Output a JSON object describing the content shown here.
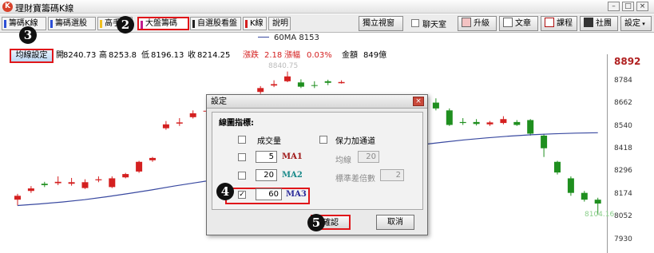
{
  "window": {
    "title": "理財寶籌碼K線",
    "icon_letter": "K"
  },
  "tabs": [
    {
      "label": "籌碼K線",
      "bar_color": "#2d4fd6"
    },
    {
      "label": "籌碼選股",
      "bar_color": "#2d4fd6"
    },
    {
      "label": "高手",
      "bar_color": "#f0c020"
    },
    {
      "label": "大盤籌碼",
      "bar_color": "#c01f8e"
    },
    {
      "label": "自選股看盤",
      "bar_color": "#222222"
    },
    {
      "label": "K線",
      "bar_color": "#d42020"
    },
    {
      "label": "說明",
      "bar_color": "#888888"
    }
  ],
  "toolbar": {
    "standalone_window": "獨立視窗",
    "chat_room": "聊天室",
    "upgrade": "升級",
    "article": "文章",
    "course": "課程",
    "community": "社團",
    "settings": "設定"
  },
  "chart": {
    "legend_ma": "60MA 8153",
    "ma_settings_button": "均線設定",
    "info": {
      "open_label": "開",
      "open": "8240.73",
      "high_label": "高",
      "high": "8253.8",
      "low_label": "低",
      "low": "8196.13",
      "close_label": "收",
      "close": "8214.25",
      "change_label": "漲跌",
      "change": "2.18",
      "pct_label": "漲幅",
      "pct": "0.03%",
      "amount_label": "金額",
      "amount": "849億"
    },
    "price_top": "8892",
    "price_ticks": [
      "8784",
      "8662",
      "8540",
      "8418",
      "8296",
      "8174",
      "8052",
      "7930"
    ],
    "high_annotation": "8840.75",
    "low_annotation": "8104.16"
  },
  "chart_data": {
    "type": "candlestick",
    "ylim": [
      7930,
      8892
    ],
    "ma_line_60": [
      8150,
      8158,
      8168,
      8180,
      8195,
      8212,
      8230,
      8250,
      8268,
      8285,
      8300,
      8318,
      8340,
      8362,
      8385,
      8410,
      8430,
      8448,
      8462,
      8475,
      8488,
      8498,
      8507,
      8514,
      8519,
      8523,
      8525
    ],
    "candles": [
      {
        "o": 8180,
        "c": 8200,
        "h": 8210,
        "l": 8150,
        "up": true
      },
      {
        "o": 8225,
        "c": 8238,
        "h": 8250,
        "l": 8215,
        "up": true
      },
      {
        "o": 8262,
        "c": 8255,
        "h": 8272,
        "l": 8245,
        "up": false
      },
      {
        "o": 8265,
        "c": 8272,
        "h": 8300,
        "l": 8255,
        "up": true
      },
      {
        "o": 8262,
        "c": 8270,
        "h": 8292,
        "l": 8252,
        "up": true
      },
      {
        "o": 8240,
        "c": 8270,
        "h": 8285,
        "l": 8235,
        "up": true
      },
      {
        "o": 8280,
        "c": 8285,
        "h": 8300,
        "l": 8270,
        "up": true
      },
      {
        "o": 8245,
        "c": 8290,
        "h": 8300,
        "l": 8240,
        "up": true
      },
      {
        "o": 8295,
        "c": 8312,
        "h": 8318,
        "l": 8290,
        "up": true
      },
      {
        "o": 8325,
        "c": 8375,
        "h": 8380,
        "l": 8318,
        "up": true
      },
      {
        "o": 8383,
        "c": 8395,
        "h": 8400,
        "l": 8375,
        "up": true
      },
      {
        "o": 8548,
        "c": 8568,
        "h": 8585,
        "l": 8540,
        "up": true
      },
      {
        "o": 8572,
        "c": 8578,
        "h": 8600,
        "l": 8560,
        "up": true
      },
      {
        "o": 8605,
        "c": 8625,
        "h": 8640,
        "l": 8598,
        "up": true
      },
      {
        "o": 8635,
        "c": 8638,
        "h": 8672,
        "l": 8625,
        "up": true
      },
      {
        "o": 8645,
        "c": 8640,
        "h": 8665,
        "l": 8620,
        "up": true
      },
      {
        "o": 8640,
        "c": 8648,
        "h": 8655,
        "l": 8615,
        "up": true
      },
      {
        "o": 8655,
        "c": 8682,
        "h": 8700,
        "l": 8650,
        "up": true
      },
      {
        "o": 8735,
        "c": 8755,
        "h": 8765,
        "l": 8725,
        "up": true
      },
      {
        "o": 8768,
        "c": 8775,
        "h": 8795,
        "l": 8760,
        "up": true
      },
      {
        "o": 8790,
        "c": 8815,
        "h": 8840,
        "l": 8785,
        "up": true
      },
      {
        "o": 8784,
        "c": 8762,
        "h": 8800,
        "l": 8755,
        "up": false
      },
      {
        "o": 8768,
        "c": 8770,
        "h": 8790,
        "l": 8755,
        "up": false
      },
      {
        "o": 8790,
        "c": 8782,
        "h": 8798,
        "l": 8770,
        "up": false
      },
      {
        "o": 8780,
        "c": 8786,
        "h": 8795,
        "l": 8778,
        "up": true
      },
      {
        "o": 8640,
        "c": 8660,
        "h": 8670,
        "l": 8620,
        "up": true
      },
      {
        "o": 8650,
        "c": 8600,
        "h": 8670,
        "l": 8595,
        "up": false
      },
      {
        "o": 8600,
        "c": 8620,
        "h": 8632,
        "l": 8590,
        "up": true
      },
      {
        "o": 8680,
        "c": 8662,
        "h": 8702,
        "l": 8655,
        "up": false
      },
      {
        "o": 8655,
        "c": 8665,
        "h": 8672,
        "l": 8648,
        "up": true
      },
      {
        "o": 8645,
        "c": 8672,
        "h": 8680,
        "l": 8640,
        "up": true
      },
      {
        "o": 8680,
        "c": 8650,
        "h": 8702,
        "l": 8640,
        "up": false
      },
      {
        "o": 8640,
        "c": 8565,
        "h": 8650,
        "l": 8560,
        "up": false
      },
      {
        "o": 8580,
        "c": 8575,
        "h": 8600,
        "l": 8565,
        "up": false
      },
      {
        "o": 8580,
        "c": 8570,
        "h": 8595,
        "l": 8562,
        "up": false
      },
      {
        "o": 8568,
        "c": 8578,
        "h": 8585,
        "l": 8560,
        "up": true
      },
      {
        "o": 8575,
        "c": 8595,
        "h": 8610,
        "l": 8568,
        "up": true
      },
      {
        "o": 8580,
        "c": 8565,
        "h": 8590,
        "l": 8560,
        "up": false
      },
      {
        "o": 8590,
        "c": 8520,
        "h": 8595,
        "l": 8510,
        "up": false
      },
      {
        "o": 8510,
        "c": 8445,
        "h": 8520,
        "l": 8400,
        "up": false
      },
      {
        "o": 8375,
        "c": 8320,
        "h": 8380,
        "l": 8310,
        "up": false
      },
      {
        "o": 8290,
        "c": 8215,
        "h": 8300,
        "l": 8200,
        "up": false
      },
      {
        "o": 8215,
        "c": 8180,
        "h": 8225,
        "l": 8170,
        "up": false
      },
      {
        "o": 8180,
        "c": 8160,
        "h": 8190,
        "l": 8104,
        "up": false
      }
    ]
  },
  "dialog": {
    "title": "設定",
    "close": "×",
    "group_title": "線圖指標:",
    "volume_label": "成交量",
    "ma1": {
      "value": "5",
      "name": "MA1",
      "color": "#a01818",
      "checked": false
    },
    "ma2": {
      "value": "20",
      "name": "MA2",
      "color": "#1a8a8a",
      "checked": false
    },
    "ma3": {
      "value": "60",
      "name": "MA3",
      "color": "#2a2a9a",
      "checked": true
    },
    "bollinger_label": "保力加通道",
    "avg_label": "均線",
    "avg_value": "20",
    "std_label": "標準差倍數",
    "std_value": "2",
    "confirm": "確認",
    "cancel": "取消"
  },
  "markers": [
    "2",
    "3",
    "4",
    "5"
  ],
  "colors": {
    "up": "#d42020",
    "down": "#1f8f1f",
    "ma": "#3949a0",
    "highlight": "#e0161a"
  }
}
